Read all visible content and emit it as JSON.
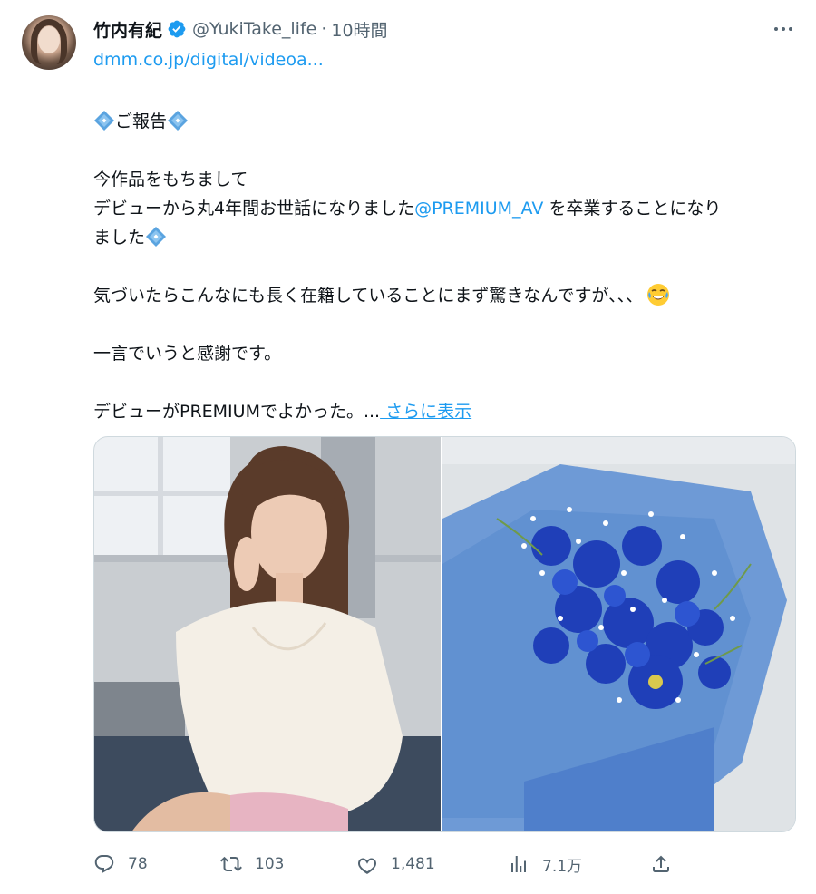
{
  "author": {
    "name": "竹内有紀",
    "handle": "@YukiTake_life",
    "separator": "·",
    "time": "10時間"
  },
  "link": "dmm.co.jp/digital/videoa...",
  "body": {
    "heading": "ご報告",
    "line1": "今作品をもちまして",
    "line2_pre": "デビューから丸4年間お世話になりました",
    "mention": "@PREMIUM_AV",
    "line2_post": " を卒業することになり",
    "line3": "ました",
    "line4": "気づいたらこんなにも長く在籍していることにまず驚きなんですが、、、",
    "line5": "一言でいうと感謝です。",
    "line6": "デビューがPREMIUMでよかった。...",
    "show_more": " さらに表示"
  },
  "icons": {
    "verified": "verified-badge-icon",
    "diamond": "diamond-blue-icon",
    "emoji": "tears-of-joy-emoji",
    "more": "more-horizontal-icon"
  },
  "actions": {
    "reply": "78",
    "retweet": "103",
    "like": "1,481",
    "views": "7.1万",
    "share": ""
  },
  "colors": {
    "link": "#1d9bf0",
    "secondary_text": "#536471",
    "primary_text": "#0f1419",
    "border": "#cfd9de"
  }
}
